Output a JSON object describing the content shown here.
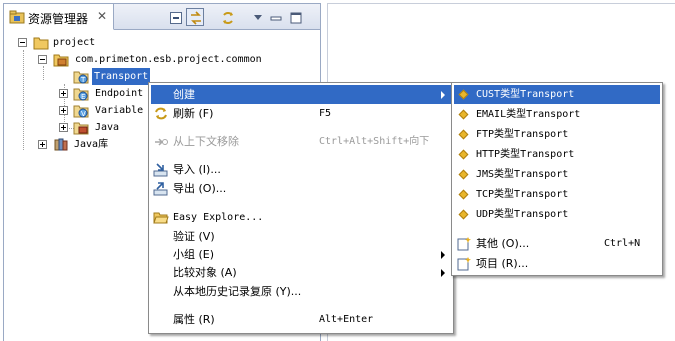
{
  "view": {
    "tab_title": "资源管理器",
    "close_glyph": "✕",
    "toolbar_icons": [
      "collapse-all-icon",
      "link-with-editor-icon",
      "sync-icon",
      "view-menu-icon",
      "minimize-icon",
      "maximize-icon"
    ]
  },
  "tree": {
    "project": "project",
    "package": "com.primeton.esb.project.common",
    "transport": "Transport",
    "endpoint": "Endpoint",
    "variable": "Variable",
    "java": "Java",
    "javalib": "Java库"
  },
  "context_menu": {
    "create": "创建",
    "refresh": "刷新 (F)",
    "refresh_acc": "F5",
    "remove": "从上下文移除",
    "remove_acc": "Ctrl+Alt+Shift+向下",
    "import": "导入 (I)...",
    "export": "导出 (O)...",
    "easy_explore": "Easy Explore...",
    "validate": "验证 (V)",
    "team": "小组 (E)",
    "compare": "比较对象 (A)",
    "restore": "从本地历史记录复原 (Y)...",
    "properties": "属性 (R)",
    "properties_acc": "Alt+Enter"
  },
  "submenu": {
    "items": [
      "CUST类型Transport",
      "EMAIL类型Transport",
      "FTP类型Transport",
      "HTTP类型Transport",
      "JMS类型Transport",
      "TCP类型Transport",
      "UDP类型Transport"
    ],
    "other": "其他 (O)...",
    "other_acc": "Ctrl+N",
    "project": "项目 (R)..."
  },
  "colors": {
    "highlight": "#316ac5",
    "border": "#9aa9c4",
    "diamond": "#e9b62b"
  }
}
